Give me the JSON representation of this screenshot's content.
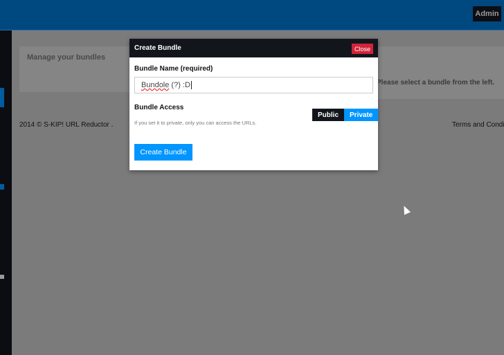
{
  "header": {
    "admin_label": "Admin"
  },
  "page": {
    "manage_title": "Manage your bundles",
    "select_hint": "Please select a bundle from the left.",
    "footer_left": "2014 © S-KIP! URL Reductor .",
    "footer_right": "Terms and Conditi"
  },
  "modal": {
    "title": "Create Bundle",
    "close_label": "Close",
    "name_label": "Bundle Name (required)",
    "name_value_word": "Bundole",
    "name_value_rest": " (?) :D",
    "access_label": "Bundle Access",
    "access_hint": "If you set it to private, only you can access the URLs.",
    "public_label": "Public",
    "private_label": "Private",
    "submit_label": "Create Bundle"
  }
}
